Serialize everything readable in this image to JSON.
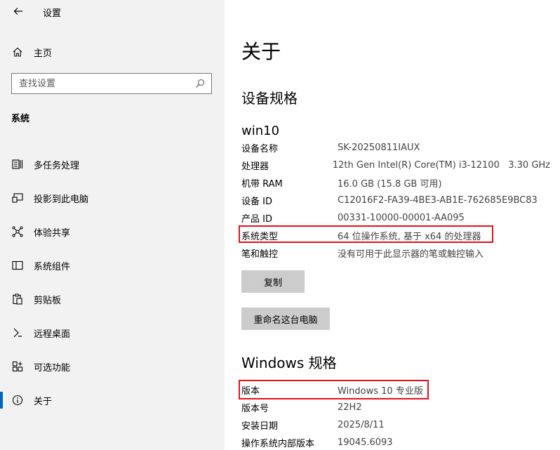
{
  "window": {
    "title": "设置"
  },
  "sidebar": {
    "home_label": "主页",
    "search_placeholder": "查找设置",
    "section": "系统",
    "items": [
      {
        "label": "多任务处理",
        "icon": "multitasking-icon"
      },
      {
        "label": "投影到此电脑",
        "icon": "projecting-icon"
      },
      {
        "label": "体验共享",
        "icon": "shared-experiences-icon"
      },
      {
        "label": "系统组件",
        "icon": "system-components-icon"
      },
      {
        "label": "剪贴板",
        "icon": "clipboard-icon"
      },
      {
        "label": "远程桌面",
        "icon": "remote-desktop-icon"
      },
      {
        "label": "可选功能",
        "icon": "optional-features-icon"
      },
      {
        "label": "关于",
        "icon": "info-icon",
        "active": true
      }
    ]
  },
  "main": {
    "title": "关于",
    "device_specs": {
      "heading": "设备规格",
      "device_name": "win10",
      "rows": [
        {
          "key": "设备名称",
          "value": "SK-20250811IAUX"
        },
        {
          "key": "处理器",
          "value": "12th Gen Intel(R) Core(TM) i3-12100   3.30 GHz"
        },
        {
          "key": "机带 RAM",
          "value": "16.0 GB (15.8 GB 可用)"
        },
        {
          "key": "设备 ID",
          "value": "C12016F2-FA39-4BE3-AB1E-762685E9BC83"
        },
        {
          "key": "产品 ID",
          "value": "00331-10000-00001-AA095"
        },
        {
          "key": "系统类型",
          "value": "64 位操作系统, 基于 x64 的处理器"
        },
        {
          "key": "笔和触控",
          "value": "没有可用于此显示器的笔或触控输入"
        }
      ],
      "copy_label": "复制",
      "rename_label": "重命名这台电脑"
    },
    "windows_specs": {
      "heading": "Windows 规格",
      "rows": [
        {
          "key": "版本",
          "value": "Windows 10 专业版"
        },
        {
          "key": "版本号",
          "value": "22H2"
        },
        {
          "key": "安装日期",
          "value": "2025/8/11"
        },
        {
          "key": "操作系统内部版本",
          "value": "19045.6093"
        }
      ]
    }
  },
  "colors": {
    "accent": "#0067c0",
    "highlight_box": "#e8101a",
    "sidebar_bg": "#f2f2f2",
    "button_bg": "#cccccc"
  }
}
